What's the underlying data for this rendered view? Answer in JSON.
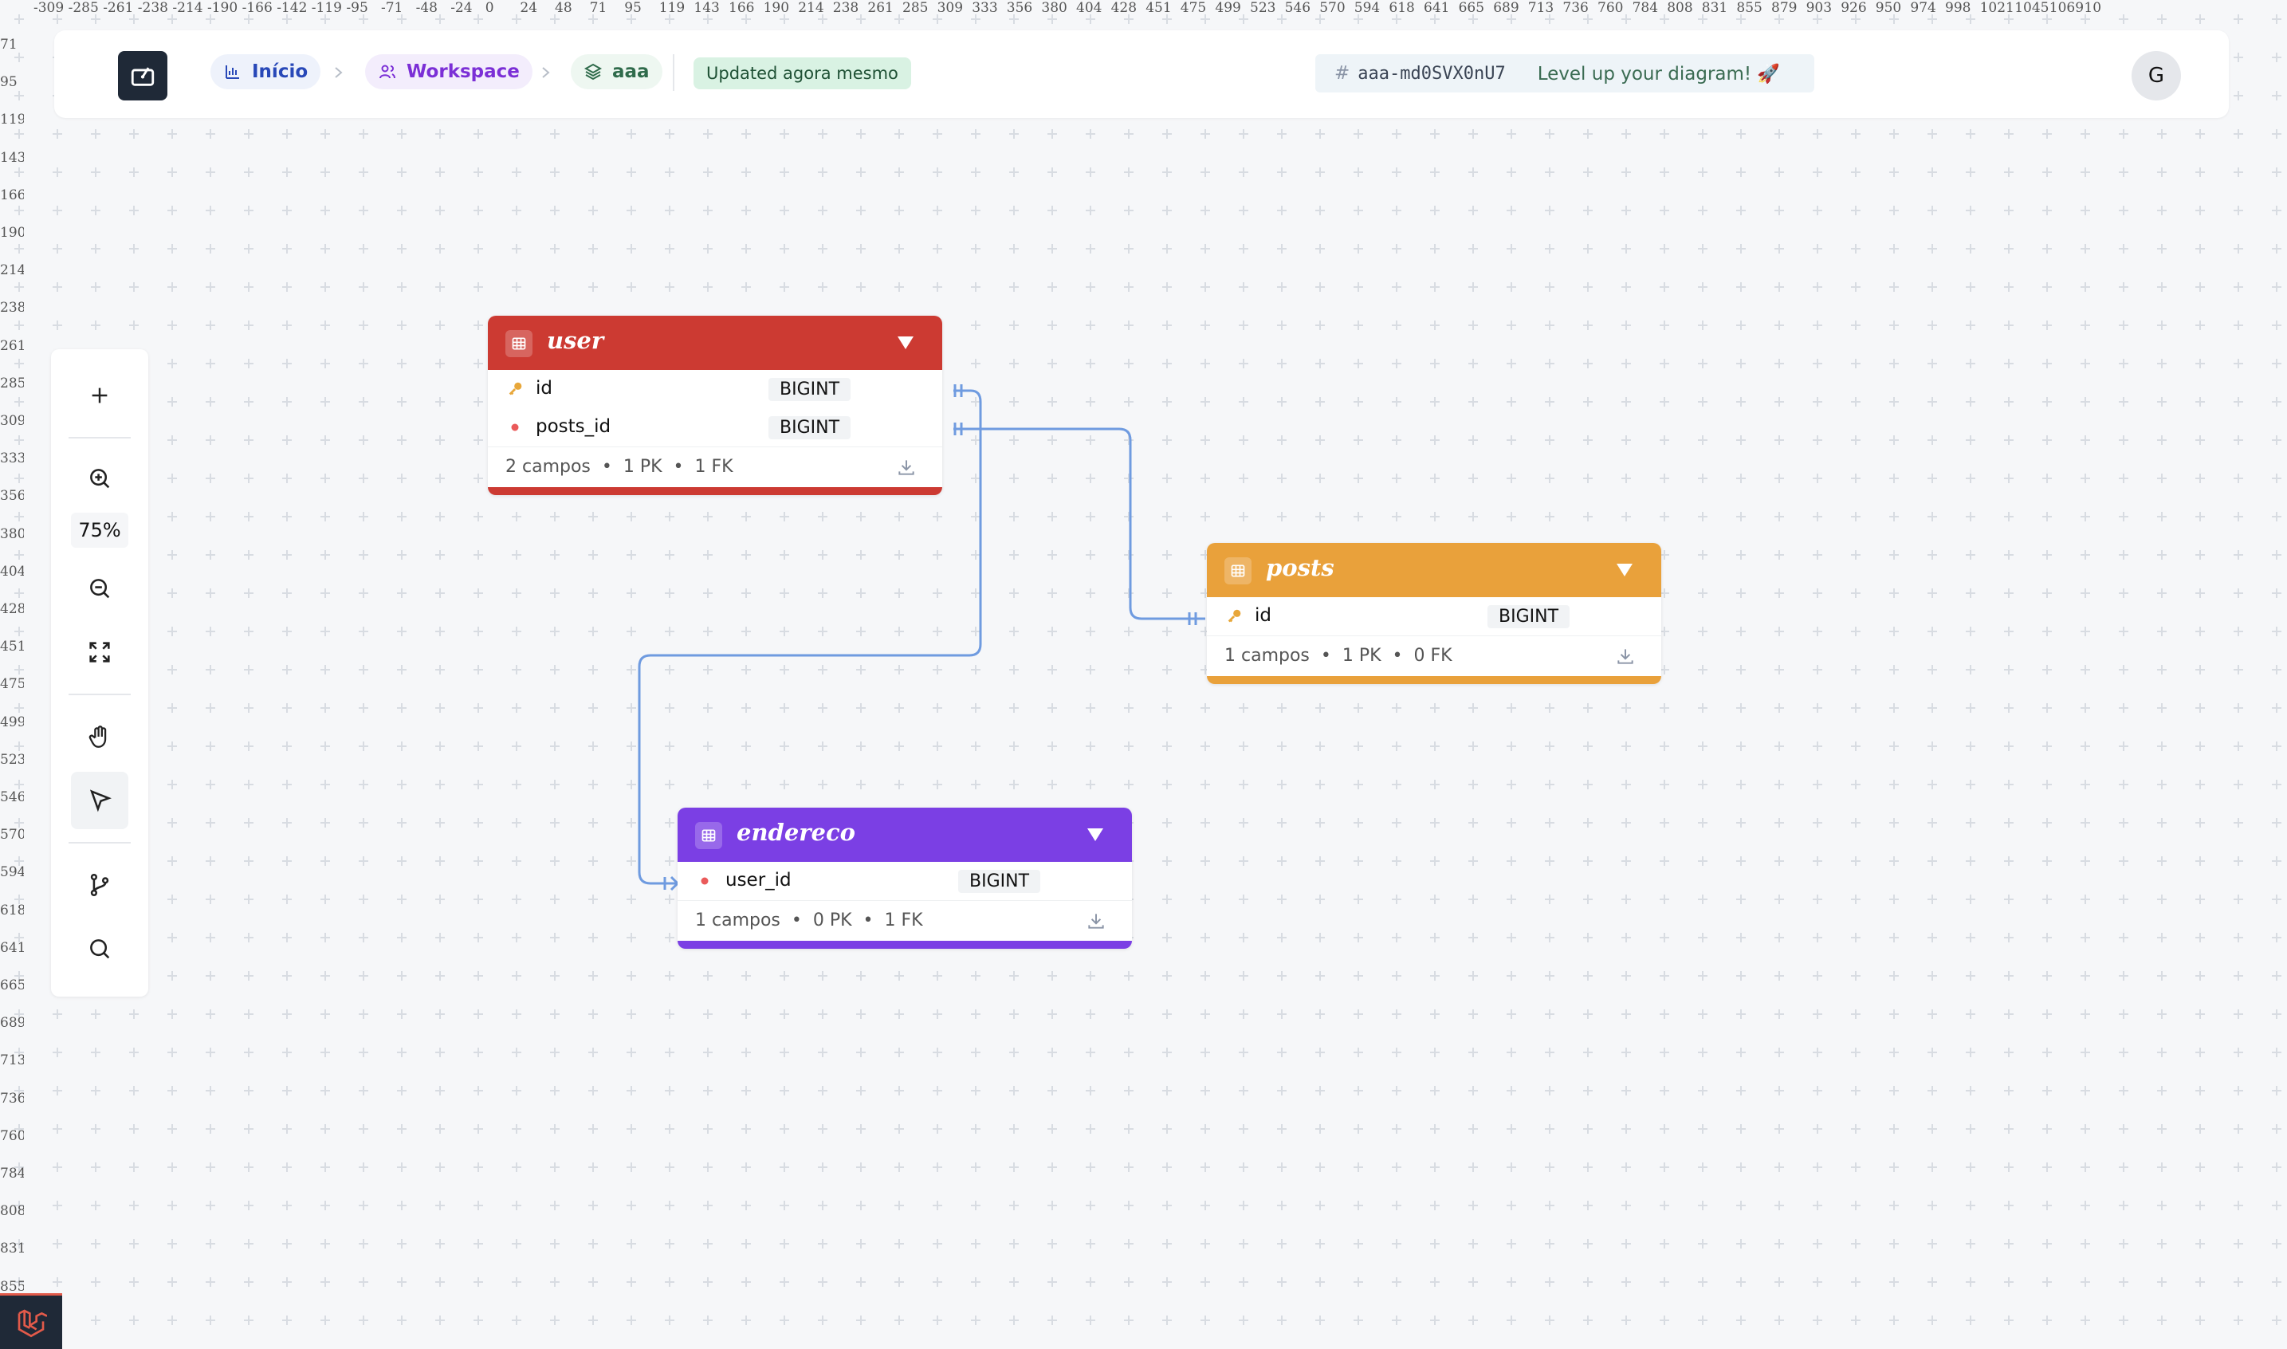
{
  "ruler": {
    "top": [
      "-309",
      "-285",
      "-261",
      "-238",
      "-214",
      "-190",
      "-166",
      "-142",
      "-119",
      "-95",
      "-71",
      "-48",
      "-24",
      "0",
      "24",
      "48",
      "71",
      "95",
      "119",
      "143",
      "166",
      "190",
      "214",
      "238",
      "261",
      "285",
      "309",
      "333",
      "356",
      "380",
      "404",
      "428",
      "451",
      "475",
      "499",
      "523",
      "546",
      "570",
      "594",
      "618",
      "641",
      "665",
      "689",
      "713",
      "736",
      "760",
      "784",
      "808",
      "831",
      "855",
      "879",
      "903",
      "926",
      "950",
      "974",
      "998",
      "1021",
      "1045",
      "1069",
      "10"
    ],
    "left": [
      "71",
      "95",
      "119",
      "143",
      "166",
      "190",
      "214",
      "238",
      "261",
      "285",
      "309",
      "333",
      "356",
      "380",
      "404",
      "428",
      "451",
      "475",
      "499",
      "523",
      "546",
      "570",
      "594",
      "618",
      "641",
      "665",
      "689",
      "713",
      "736",
      "760",
      "784",
      "808",
      "831",
      "855"
    ]
  },
  "header": {
    "breadcrumbs": [
      {
        "label": "Início",
        "icon": "chart-icon"
      },
      {
        "label": "Workspace",
        "icon": "users-icon"
      },
      {
        "label": "aaa",
        "icon": "layers-icon"
      }
    ],
    "status_badge": "Updated agora mesmo",
    "diagram_id_hash": "#",
    "diagram_id": "aaa-md0SVX0nU7",
    "promo": "Level up your diagram! 🚀",
    "avatar_initial": "G"
  },
  "toolbar": {
    "zoom_level": "75%",
    "tools": [
      "plus-icon",
      "zoom-in-icon",
      "zoom-out-icon",
      "fit-screen-icon",
      "hand-icon",
      "pointer-icon",
      "branch-icon",
      "search-icon"
    ],
    "active_tool": "pointer-icon"
  },
  "tables": [
    {
      "name": "user",
      "color": "#cc3a32",
      "fields": [
        {
          "name": "id",
          "type": "BIGINT",
          "marker": "key"
        },
        {
          "name": "posts_id",
          "type": "BIGINT",
          "marker": "dot"
        }
      ],
      "footer": "2 campos  •  1 PK  •  1 FK"
    },
    {
      "name": "posts",
      "color": "#e9a13b",
      "fields": [
        {
          "name": "id",
          "type": "BIGINT",
          "marker": "key"
        }
      ],
      "footer": "1 campos  •  1 PK  •  0 FK"
    },
    {
      "name": "endereco",
      "color": "#7b3fe4",
      "fields": [
        {
          "name": "user_id",
          "type": "BIGINT",
          "marker": "dot"
        }
      ],
      "footer": "1 campos  •  0 PK  •  1 FK"
    }
  ],
  "colors": {
    "relation_line": "#6f9be0",
    "badge_bg": "#d9f2e3",
    "crumb_home": "#2848b8",
    "crumb_workspace": "#7b2fd6",
    "crumb_project": "#2f6b4b"
  }
}
